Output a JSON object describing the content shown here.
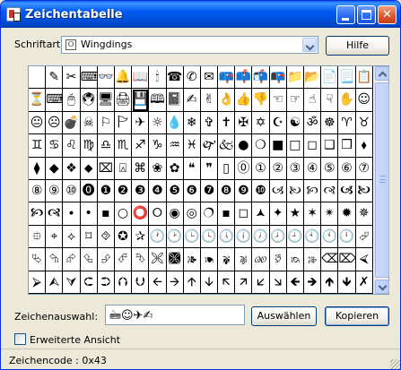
{
  "window": {
    "title": "Zeichentabelle",
    "minimize_glyph": "",
    "maximize_glyph": "",
    "close_glyph": "✕"
  },
  "font": {
    "label": "Schriftart:",
    "value": "Wingdings"
  },
  "help_button": "Hilfe",
  "char_grid": {
    "selected_index": 26,
    "rows": [
      [
        "",
        "✎",
        "✂",
        "⌨",
        "👓",
        "🔔",
        "📖",
        "🕯",
        "☎",
        "✆",
        "✉",
        "📪",
        "📫",
        "📬",
        "📭",
        "📁",
        "📂",
        "📄",
        "📃",
        "📋"
      ],
      [
        "⏳",
        "⌨",
        "🖱",
        "🖲",
        "🖥",
        "🖨",
        "💾",
        "🕮",
        "📓",
        "✍",
        "✌",
        "👌",
        "👍",
        "👎",
        "☜",
        "☞",
        "☝",
        "☟",
        "✋",
        "☺"
      ],
      [
        "😐",
        "☹",
        "💣",
        "☠",
        "⚐",
        "🏱",
        "✈",
        "☼",
        "💧",
        "❄",
        "✞",
        "✝",
        "✠",
        "✡",
        "☪",
        "☯",
        "ॐ",
        "☸",
        "♈",
        "♉"
      ],
      [
        "♊",
        "♋",
        "♌",
        "♍",
        "♎",
        "♏",
        "♐",
        "♑",
        "♒",
        "♓",
        "🙰",
        "🙵",
        "●",
        "❍",
        "■",
        "□",
        "◻",
        "❑",
        "❒",
        "⬧"
      ],
      [
        "⧫",
        "◆",
        "❖",
        "⬥",
        "⌧",
        "⍓",
        "⌘",
        "❀",
        "✿",
        "❝",
        "❞",
        "▯",
        "⓪",
        "①",
        "②",
        "③",
        "④",
        "⑤",
        "⑥",
        "⑦"
      ],
      [
        "⑧",
        "⑨",
        "⑩",
        "⓿",
        "❶",
        "❷",
        "❸",
        "❹",
        "❺",
        "❻",
        "❼",
        "❽",
        "❾",
        "❿",
        "🙢",
        "🙠",
        "🙡",
        "🙣",
        "🙦",
        "🙤"
      ],
      [
        "🙥",
        "🙧",
        "∙",
        "•",
        "▪",
        "○",
        "⭕",
        "⭘",
        "◉",
        "◎",
        "🔿",
        "▪",
        "◻",
        "🟂",
        "✦",
        "★",
        "✶",
        "✴",
        "✹",
        "✵"
      ],
      [
        "⯐",
        "⌖",
        "⟡",
        "⌑",
        "⯑",
        "✪",
        "✰",
        "🕐",
        "🕑",
        "🕒",
        "🕓",
        "🕔",
        "🕕",
        "🕖",
        "🕗",
        "🕘",
        "🕙",
        "🕚",
        "🕛",
        "⮰"
      ],
      [
        "⮱",
        "⮲",
        "⮳",
        "⮴",
        "⮵",
        "⮶",
        "⮷",
        "🙪",
        "🙫",
        "🙕",
        "🙔",
        "🙗",
        "🙖",
        "🙐",
        "🙑",
        "🙒",
        "🙓",
        "⌫",
        "⌦",
        "⮘"
      ],
      [
        "⮚",
        "⮙",
        "⮛",
        "⮈",
        "⮊",
        "⮉",
        "⮋",
        "🡨",
        "🡪",
        "🡩",
        "🡫",
        "🡬",
        "🡭",
        "🡯",
        "🡮",
        "🡸",
        "🡺",
        "🡹",
        "🡻",
        "✗"
      ]
    ]
  },
  "chars_to_copy": {
    "label": "Zeichenauswahl:",
    "value": "🖮☺✈✍"
  },
  "select_button": "Auswählen",
  "copy_button": "Kopieren",
  "advanced_view": {
    "label": "Erweiterte Ansicht",
    "checked": false
  },
  "status_bar": "Zeichencode : 0x43"
}
